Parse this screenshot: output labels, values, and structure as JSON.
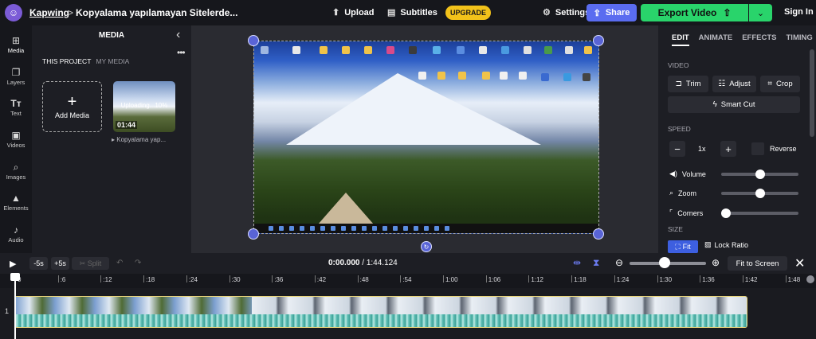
{
  "header": {
    "brand": "Kapwing",
    "separator": ">",
    "project_title": "Kopyalama yapılamayan Sitelerde...",
    "upload_label": "Upload",
    "subtitles_label": "Subtitles",
    "upgrade_label": "UPGRADE",
    "settings_label": "Settings",
    "share_label": "Share",
    "export_label": "Export Video",
    "signin_label": "Sign In"
  },
  "leftnav": {
    "items": [
      {
        "label": "Media",
        "icon": "media-icon"
      },
      {
        "label": "Layers",
        "icon": "layers-icon"
      },
      {
        "label": "Text",
        "icon": "text-icon"
      },
      {
        "label": "Videos",
        "icon": "videos-icon"
      },
      {
        "label": "Images",
        "icon": "images-icon"
      },
      {
        "label": "Elements",
        "icon": "elements-icon"
      },
      {
        "label": "Audio",
        "icon": "audio-icon"
      }
    ]
  },
  "media_panel": {
    "title": "MEDIA",
    "tabs": [
      "THIS PROJECT",
      "MY MEDIA"
    ],
    "add_media_label": "Add Media",
    "item": {
      "status": "Uploading...10%",
      "duration": "01:44",
      "name": "Kopyalama yap..."
    }
  },
  "right_panel": {
    "tabs": [
      "EDIT",
      "ANIMATE",
      "EFFECTS",
      "TIMING"
    ],
    "video_section": "VIDEO",
    "trim_label": "Trim",
    "adjust_label": "Adjust",
    "crop_label": "Crop",
    "smartcut_label": "Smart Cut",
    "speed_section": "SPEED",
    "speed_value": "1x",
    "reverse_label": "Reverse",
    "volume_label": "Volume",
    "volume_level": 0.5,
    "zoom_label": "Zoom",
    "zoom_level": 0.5,
    "corners_label": "Corners",
    "corners_level": 0,
    "size_section": "SIZE",
    "fit_label": "Fit",
    "lock_ratio_label": "Lock Ratio"
  },
  "timeline": {
    "minus5": "-5s",
    "plus5": "+5s",
    "split_label": "Split",
    "current_time": "0:00.000",
    "total_time": "/ 1:44.124",
    "fit_to_screen_label": "Fit to Screen",
    "zoom_level": 0.45,
    "track_number": "1",
    "ticks": [
      "0",
      ":6",
      ":12",
      ":18",
      ":24",
      ":30",
      ":36",
      ":42",
      ":48",
      ":54",
      "1:00",
      "1:06",
      "1:12",
      "1:18",
      "1:24",
      "1:30",
      "1:36",
      "1:42",
      "1:48"
    ]
  },
  "colors": {
    "accent": "#5a6cf0",
    "export_green": "#29d46b",
    "upgrade_yellow": "#f2c21a",
    "track_border": "#e9d57a"
  }
}
